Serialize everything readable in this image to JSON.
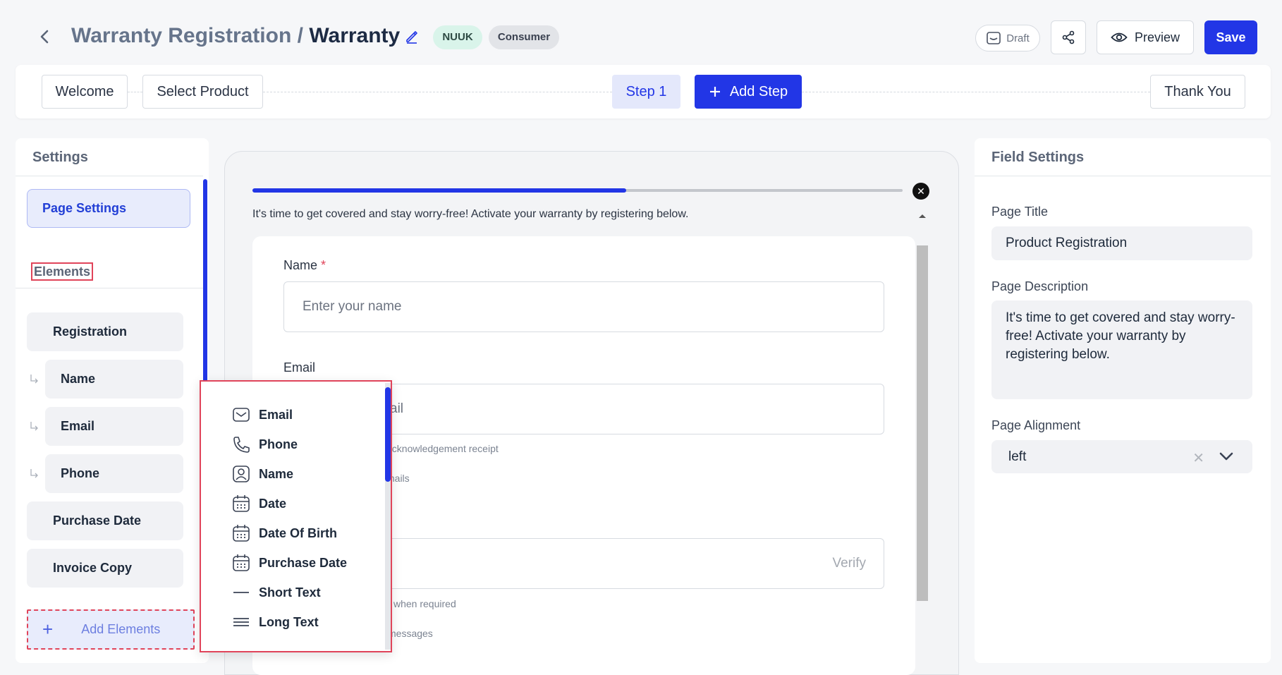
{
  "header": {
    "title_parent": "Warranty Registration",
    "title_sep": "/",
    "title_current": "Warranty",
    "badges": [
      "NUUK",
      "Consumer"
    ],
    "draft_label": "Draft",
    "preview_label": "Preview",
    "save_label": "Save"
  },
  "steps": {
    "welcome": "Welcome",
    "select_product": "Select Product",
    "step1": "Step 1",
    "add_step": "Add Step",
    "thank_you": "Thank You"
  },
  "left_panel": {
    "settings_title": "Settings",
    "page_settings": "Page Settings",
    "elements_title": "Elements",
    "elements": [
      {
        "label": "Registration",
        "child": false
      },
      {
        "label": "Name",
        "child": true
      },
      {
        "label": "Email",
        "child": true
      },
      {
        "label": "Phone",
        "child": true
      },
      {
        "label": "Purchase Date",
        "child": false
      },
      {
        "label": "Invoice Copy",
        "child": false
      }
    ],
    "add_elements": "Add Elements"
  },
  "center": {
    "progress_fraction": 0.575,
    "intro": "It's time to get covered and stay worry-free! Activate your warranty by registering below.",
    "name_label": "Name",
    "required_mark": "*",
    "name_placeholder": "Enter your name",
    "email_label": "Email",
    "email_placeholder_visible": "ail",
    "email_hint": "acknowledgement receipt",
    "email_hint2": "mails",
    "verify_label": "Verify",
    "phone_hint": "when required",
    "phone_hint2": "messages"
  },
  "dropdown": {
    "items": [
      {
        "label": "Email",
        "icon": "mail-icon"
      },
      {
        "label": "Phone",
        "icon": "phone-icon"
      },
      {
        "label": "Name",
        "icon": "user-icon"
      },
      {
        "label": "Date",
        "icon": "calendar-icon"
      },
      {
        "label": "Date Of Birth",
        "icon": "calendar-icon"
      },
      {
        "label": "Purchase Date",
        "icon": "calendar-icon"
      },
      {
        "label": "Short Text",
        "icon": "short-text-icon"
      },
      {
        "label": "Long Text",
        "icon": "long-text-icon"
      }
    ]
  },
  "right_panel": {
    "title": "Field Settings",
    "page_title_label": "Page Title",
    "page_title_value": "Product Registration",
    "page_desc_label": "Page Description",
    "page_desc_value": "It's time to get covered and stay worry-free! Activate your warranty by registering below.",
    "page_align_label": "Page Alignment",
    "page_align_value": "left"
  },
  "colors": {
    "accent": "#2236e6",
    "highlight_border": "#e0445a"
  }
}
